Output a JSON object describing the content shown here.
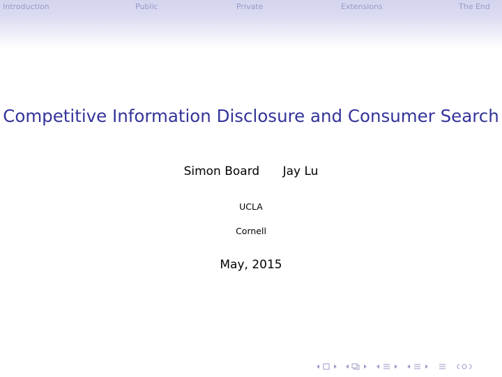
{
  "nav": {
    "sections": [
      {
        "label": "Introduction"
      },
      {
        "label": "Public"
      },
      {
        "label": "Private"
      },
      {
        "label": "Extensions"
      },
      {
        "label": "The End"
      }
    ]
  },
  "slide": {
    "title": "Competitive Information Disclosure and Consumer Search",
    "authors": [
      "Simon Board",
      "Jay Lu"
    ],
    "institutions": [
      "UCLA",
      "Cornell"
    ],
    "date": "May, 2015"
  },
  "navigation_symbols": {
    "icons": [
      "frame-nav-icon",
      "subsection-nav-icon",
      "section-nav-icon",
      "document-nav-icon",
      "appendix-nav-icon",
      "search-icon"
    ],
    "color": "#9999c8"
  },
  "colors": {
    "title": "#33339a",
    "header_gradient_top": "#d4d4ee",
    "nav_text": "#9999c8"
  }
}
